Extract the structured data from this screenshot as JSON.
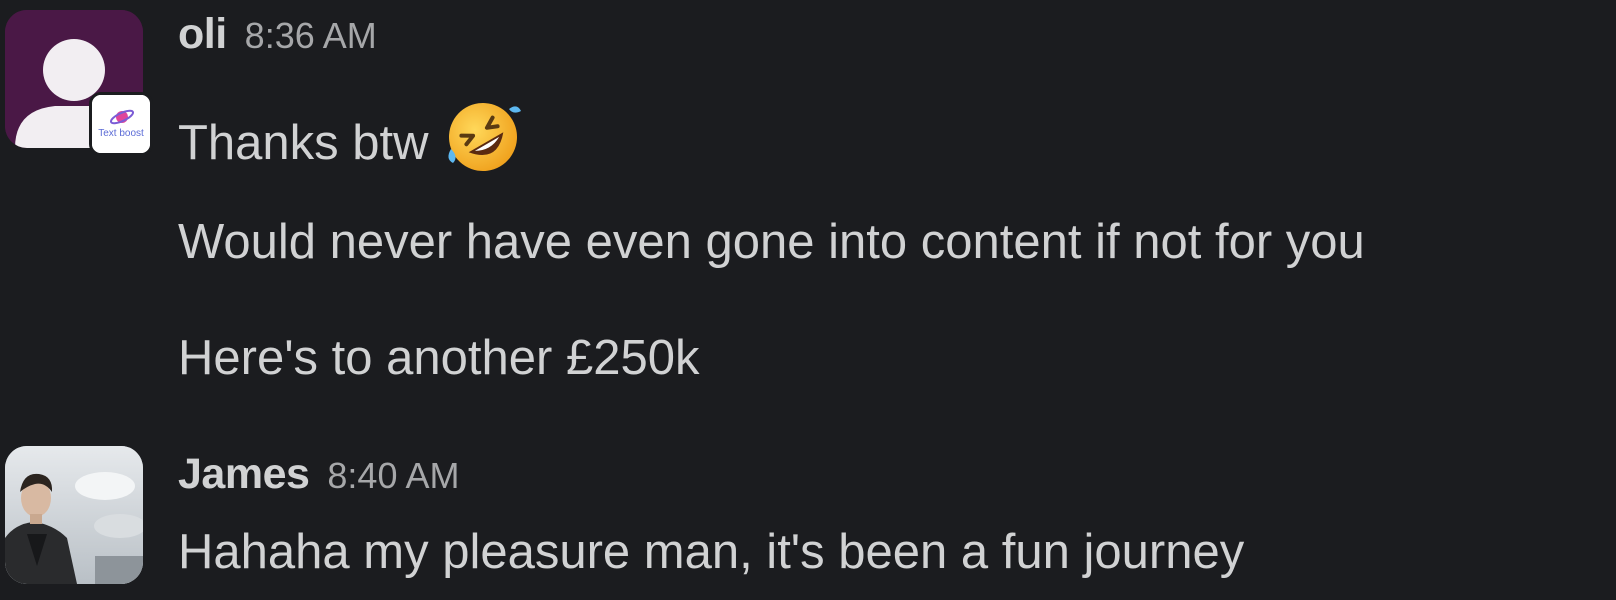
{
  "messages": [
    {
      "author": "oli",
      "time": "8:36 AM",
      "avatar_icon": "default-user-avatar-icon",
      "badge": {
        "icon": "textboost-logo-icon",
        "text": "Text boost"
      },
      "lines": [
        "Thanks btw",
        "Would never have even gone into content if not for you",
        "Here's to another £250k"
      ],
      "emoji": "rolling-on-floor-laughing-emoji"
    },
    {
      "author": "James",
      "time": "8:40 AM",
      "avatar_icon": "profile-photo-avatar",
      "lines": [
        "Hahaha my pleasure man, it's been a fun journey"
      ]
    }
  ],
  "colors": {
    "background": "#1b1c1f",
    "text": "#d1d2d3",
    "timestamp": "#a6a7a9",
    "oli_avatar_bg": "#4a1846",
    "emoji_yellow": "#f7b731"
  }
}
